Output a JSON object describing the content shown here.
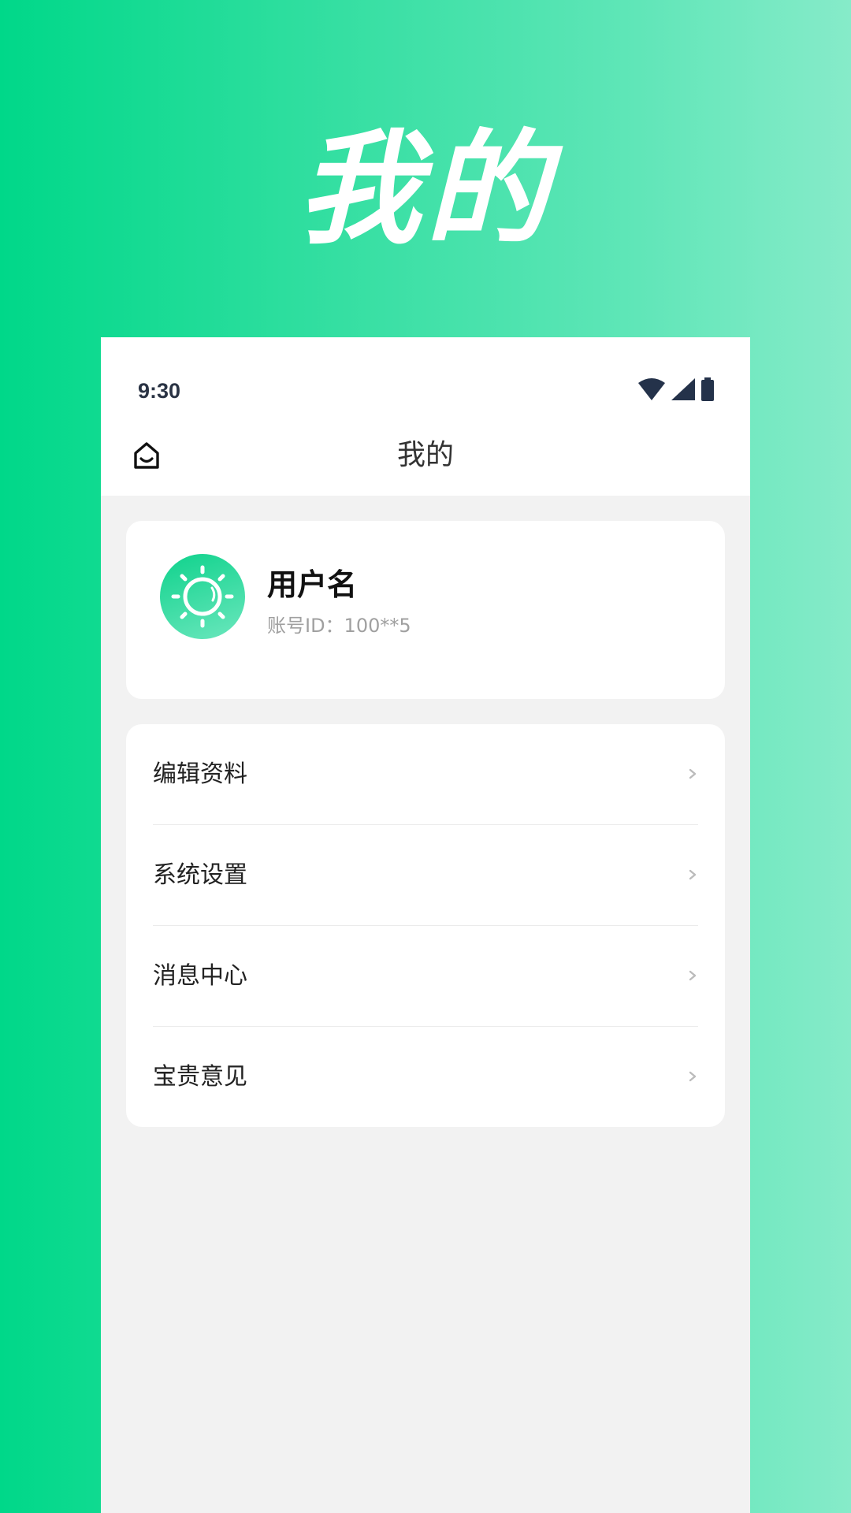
{
  "promo": {
    "title": "我的"
  },
  "status_bar": {
    "time": "9:30"
  },
  "nav": {
    "title": "我的",
    "home_icon": "home-smile-icon"
  },
  "profile": {
    "username": "用户名",
    "account_id": "账号ID：100**5",
    "avatar_icon": "sun-icon"
  },
  "menu": {
    "items": [
      {
        "label": "编辑资料"
      },
      {
        "label": "系统设置"
      },
      {
        "label": "消息中心"
      },
      {
        "label": "宝贵意见"
      }
    ]
  },
  "colors": {
    "accent": "#00d889",
    "accent_light": "#86ebc9",
    "background": "#f2f2f2"
  }
}
